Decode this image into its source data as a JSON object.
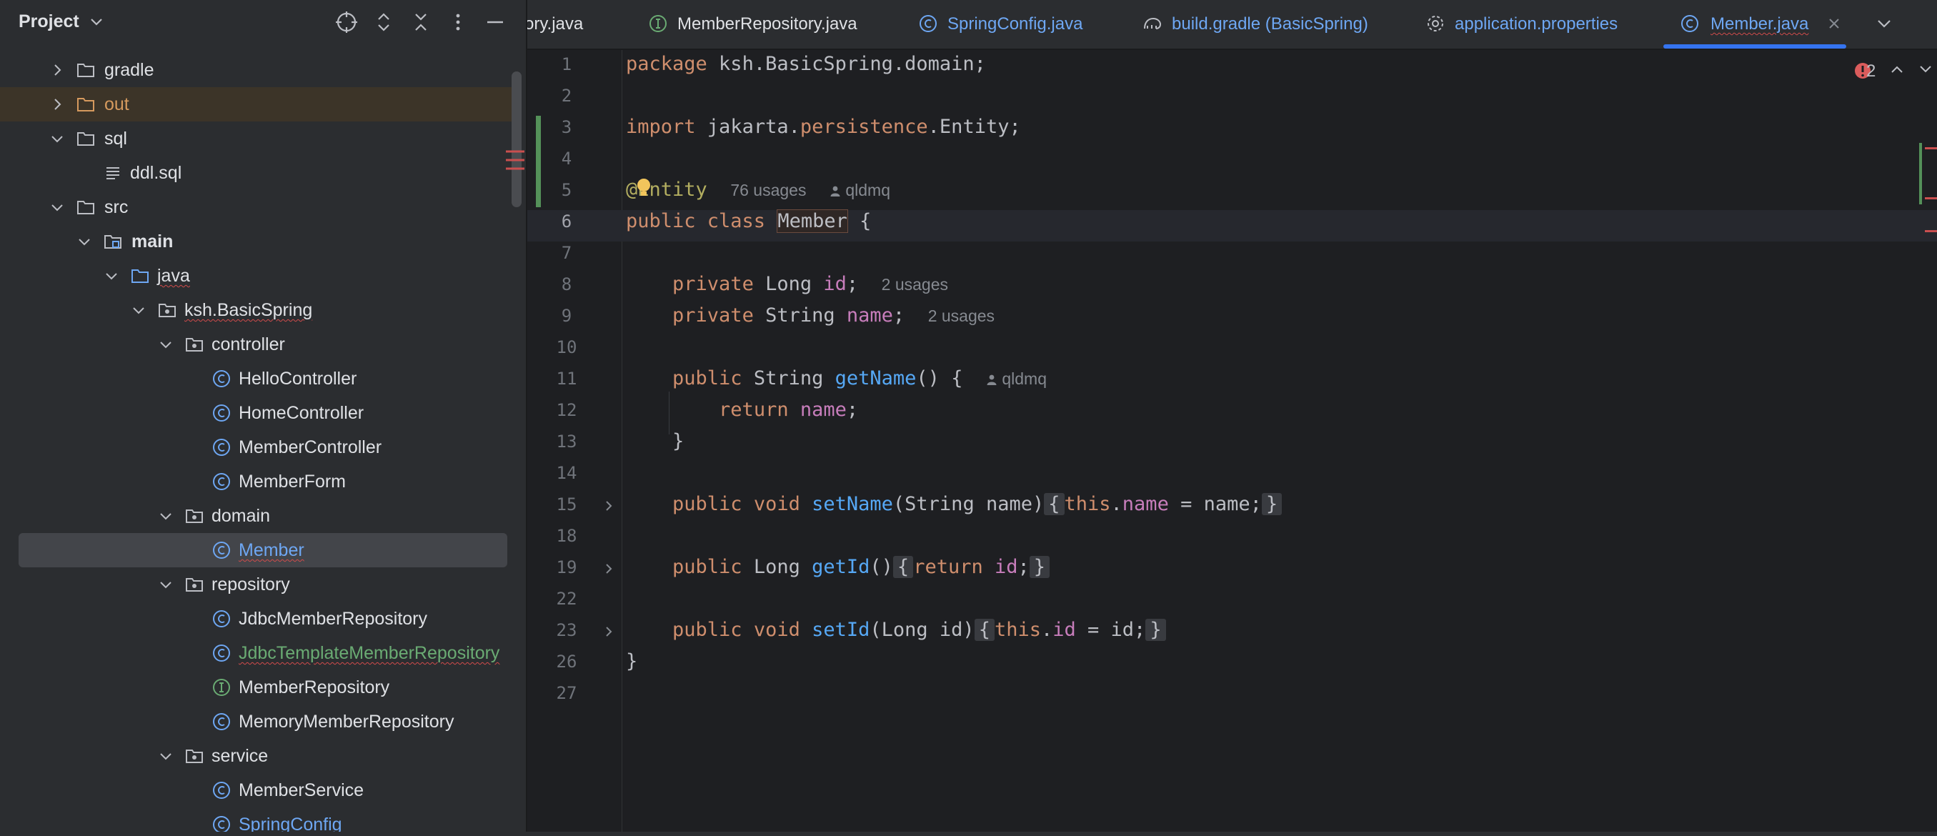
{
  "project_panel": {
    "title": "Project",
    "tree": [
      {
        "label": "gradle",
        "type": "folder",
        "expanded": false
      },
      {
        "label": "out",
        "type": "folder-excluded",
        "expanded": false
      },
      {
        "label": "sql",
        "type": "folder",
        "expanded": true
      },
      {
        "label": "ddl.sql",
        "type": "file-text"
      },
      {
        "label": "src",
        "type": "folder",
        "expanded": true
      },
      {
        "label": "main",
        "type": "module-folder",
        "expanded": true
      },
      {
        "label": "java",
        "type": "source-folder",
        "expanded": true
      },
      {
        "label": "ksh.BasicSpring",
        "type": "package",
        "expanded": true
      },
      {
        "label": "controller",
        "type": "package",
        "expanded": true
      },
      {
        "label": "HelloController",
        "type": "class"
      },
      {
        "label": "HomeController",
        "type": "class"
      },
      {
        "label": "MemberController",
        "type": "class"
      },
      {
        "label": "MemberForm",
        "type": "class"
      },
      {
        "label": "domain",
        "type": "package",
        "expanded": true
      },
      {
        "label": "Member",
        "type": "class",
        "selected": true
      },
      {
        "label": "repository",
        "type": "package",
        "expanded": true
      },
      {
        "label": "JdbcMemberRepository",
        "type": "class"
      },
      {
        "label": "JdbcTemplateMemberRepository",
        "type": "class"
      },
      {
        "label": "MemberRepository",
        "type": "interface"
      },
      {
        "label": "MemoryMemberRepository",
        "type": "class"
      },
      {
        "label": "service",
        "type": "package",
        "expanded": true
      },
      {
        "label": "MemberService",
        "type": "class"
      },
      {
        "label": "SpringConfig",
        "type": "class"
      }
    ]
  },
  "tabs": [
    {
      "label": "ory.java",
      "icon": "class-icon"
    },
    {
      "label": "MemberRepository.java",
      "icon": "interface-icon"
    },
    {
      "label": "SpringConfig.java",
      "icon": "class-icon"
    },
    {
      "label": "build.gradle (BasicSpring)",
      "icon": "gradle-icon"
    },
    {
      "label": "application.properties",
      "icon": "gear-icon"
    },
    {
      "label": "Member.java",
      "icon": "class-icon",
      "active": true
    }
  ],
  "editor": {
    "error_count": "2",
    "line_numbers": [
      "1",
      "2",
      "3",
      "4",
      "5",
      "6",
      "7",
      "8",
      "9",
      "10",
      "11",
      "12",
      "13",
      "14",
      "15",
      "18",
      "19",
      "22",
      "23",
      "26",
      "27"
    ],
    "lines": {
      "l1_pkg_kw": "package",
      "l1_pkg_name": " ksh.BasicSpring.domain;",
      "l3_kw": "import",
      "l3_a": " jakarta.",
      "l3_b": "persistence",
      "l3_c": ".Entity;",
      "l5_ann": "@Entity",
      "l5_usages": "76 usages",
      "l5_author": "qldmq",
      "l6_kw": "public class",
      "l6_name": "Member",
      "l6_brace": " {",
      "l8_kw": "private",
      "l8_type": " Long ",
      "l8_field": "id",
      "l8_semi": ";",
      "l8_hint": "2 usages",
      "l9_kw": "private",
      "l9_type": " String ",
      "l9_field": "name",
      "l9_semi": ";",
      "l9_hint": "2 usages",
      "l11_kw": "public",
      "l11_type": " String ",
      "l11_fn": "getName",
      "l11_rest": "() {",
      "l11_author": "qldmq",
      "l12_kw": "return",
      "l12_field": "name",
      "l12_semi": ";",
      "l13": "}",
      "l15_kw": "public void",
      "l15_fn": "setName",
      "l15_params": "(String name)",
      "l15_ob": "{",
      "l15_this": "this",
      "l15_dot": ".",
      "l15_field": "name",
      "l15_rest": " = name;",
      "l15_cb": "}",
      "l19_kw": "public",
      "l19_type": " Long ",
      "l19_fn": "getId",
      "l19_params": "()",
      "l19_ob": "{",
      "l19_ret": "return",
      "l19_field": "id",
      "l19_semi": ";",
      "l19_cb": "}",
      "l23_kw": "public void",
      "l23_fn": "setId",
      "l23_params": "(Long id)",
      "l23_ob": "{",
      "l23_this": "this",
      "l23_dot": ".",
      "l23_field": "id",
      "l23_rest": " = id;",
      "l23_cb": "}",
      "l26": "}"
    }
  }
}
